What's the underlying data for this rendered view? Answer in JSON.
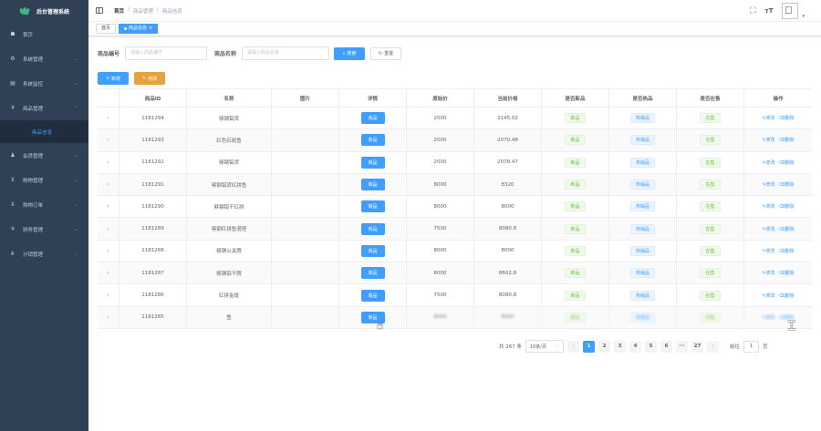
{
  "sidebar": {
    "brand": "后台管理系统",
    "items": [
      {
        "icon": "dashboard-icon",
        "glyph": "☗",
        "label": "首页",
        "arrow": ""
      },
      {
        "icon": "gear-icon",
        "glyph": "⚙",
        "label": "系统管理",
        "arrow": "⌄"
      },
      {
        "icon": "monitor-icon",
        "glyph": "▤",
        "label": "系统监控",
        "arrow": "⌄"
      },
      {
        "icon": "yen-icon",
        "glyph": "¥",
        "label": "商品管理",
        "arrow": "⌃"
      }
    ],
    "submenu": {
      "label": "商品信息"
    },
    "items_after": [
      {
        "icon": "user-icon",
        "glyph": "♟",
        "label": "会员管理",
        "arrow": "⌄"
      },
      {
        "icon": "cart-icon",
        "glyph": "⊻",
        "label": "购物管理",
        "arrow": "⌄"
      },
      {
        "icon": "cart-icon",
        "glyph": "⊻",
        "label": "购物订单",
        "arrow": "⌄"
      },
      {
        "icon": "yen-icon",
        "glyph": "¥",
        "label": "财务管理",
        "arrow": "⌄"
      },
      {
        "icon": "share-icon",
        "glyph": "⋔",
        "label": "分销管理",
        "arrow": "⌄"
      }
    ]
  },
  "navbar": {
    "breadcrumb": [
      "首页",
      "商品管理",
      "商品信息"
    ],
    "separator": "/",
    "fullscreen_glyph": "⛶",
    "size_glyph": "ᴛT"
  },
  "tags": {
    "home": "首页",
    "active": "商品信息",
    "close": "×"
  },
  "search": {
    "code_label": "商品编号",
    "code_placeholder": "请输入商品编号",
    "name_label": "商品名称",
    "name_placeholder": "请输入商品名称",
    "search_btn": "搜索",
    "reset_btn": "重置"
  },
  "actions": {
    "add": "新增",
    "edit": "修改"
  },
  "table": {
    "headers": [
      "",
      "商品ID",
      "名称",
      "图片",
      "详情",
      "原始价",
      "当前价格",
      "是否新品",
      "是否热品",
      "是否在售",
      "操作"
    ],
    "detail_label": "商品",
    "edit_label": "修改",
    "delete_label": "删除",
    "rows": [
      {
        "id": "1181294",
        "name": "够钢铝货",
        "orig": "2000",
        "cur": "2145.02",
        "new": "新品",
        "hot": "热销品",
        "sale": "在售"
      },
      {
        "id": "1181293",
        "name": "红色石斑鱼",
        "orig": "2000",
        "cur": "2070.48",
        "new": "新品",
        "hot": "热销品",
        "sale": "在售"
      },
      {
        "id": "1181292",
        "name": "够钢铝货",
        "orig": "2000",
        "cur": "2078.47",
        "new": "新品",
        "hot": "热销品",
        "sale": "在售"
      },
      {
        "id": "1181291",
        "name": "够钢铝货红拼鱼",
        "orig": "8000",
        "cur": "8320",
        "new": "新品",
        "hot": "热销品",
        "sale": "在售"
      },
      {
        "id": "1181290",
        "name": "够钢铝干红拼",
        "orig": "8000",
        "cur": "8000",
        "new": "新品",
        "hot": "热销品",
        "sale": "在售"
      },
      {
        "id": "1181289",
        "name": "够钢红拼鱼混搭",
        "orig": "7500",
        "cur": "8080.8",
        "new": "新品",
        "hot": "热销品",
        "sale": "在售"
      },
      {
        "id": "1181288",
        "name": "够钢公关牌",
        "orig": "8000",
        "cur": "8000",
        "new": "新品",
        "hot": "热销品",
        "sale": "在售"
      },
      {
        "id": "1181287",
        "name": "够钢铝干牌",
        "orig": "8000",
        "cur": "8602.8",
        "new": "新品",
        "hot": "热销品",
        "sale": "在售"
      },
      {
        "id": "1181286",
        "name": "红拼金斑",
        "orig": "7500",
        "cur": "8080.8",
        "new": "新品",
        "hot": "热销品",
        "sale": "在售"
      },
      {
        "id": "1181285",
        "name": "鱼",
        "orig": "8000",
        "cur": "8000",
        "new": "新品",
        "hot": "热销品",
        "sale": "在售"
      }
    ]
  },
  "pagination": {
    "total": "共 267 条",
    "page_size": "10条/页",
    "prev": "‹",
    "next": "›",
    "pages": [
      "1",
      "2",
      "3",
      "4",
      "5",
      "6",
      "···",
      "27"
    ],
    "goto_label": "前往",
    "goto_value": "1",
    "goto_suffix": "页"
  },
  "colors": {
    "primary": "#409eff",
    "warning": "#e6a23c",
    "sidebar": "#304156",
    "success": "#67c23a"
  }
}
